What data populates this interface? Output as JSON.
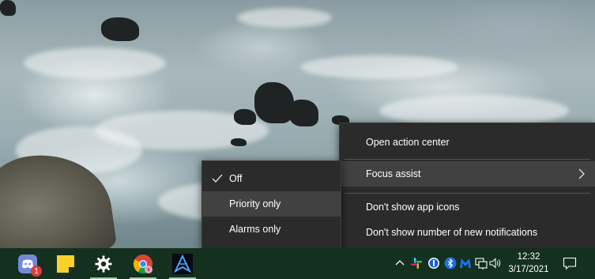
{
  "main_menu": {
    "items": [
      {
        "label": "Open action center"
      },
      {
        "label": "Focus assist"
      },
      {
        "label": "Don't show app icons"
      },
      {
        "label": "Don't show number of new notifications"
      }
    ]
  },
  "focus_submenu": {
    "items": [
      {
        "label": "Off",
        "checked": true
      },
      {
        "label": "Priority only"
      },
      {
        "label": "Alarms only"
      }
    ]
  },
  "taskbar": {
    "apps": [
      {
        "icon": "discord-icon",
        "badge": "1"
      },
      {
        "icon": "sticky-notes-icon"
      },
      {
        "icon": "settings-gear-icon"
      },
      {
        "icon": "chrome-icon"
      },
      {
        "icon": "app-icon"
      }
    ],
    "tray": {
      "icons": [
        "chevron-up-icon",
        "slack-icon",
        "1password-icon",
        "bluetooth-icon",
        "malwarebytes-icon",
        "network-icon",
        "volume-icon"
      ]
    },
    "clock": {
      "time": "12:32",
      "date": "3/17/2021"
    }
  },
  "colors": {
    "menu_bg": "#2b2b2b",
    "menu_highlight": "#414141",
    "taskbar_bg": "#14301e"
  }
}
